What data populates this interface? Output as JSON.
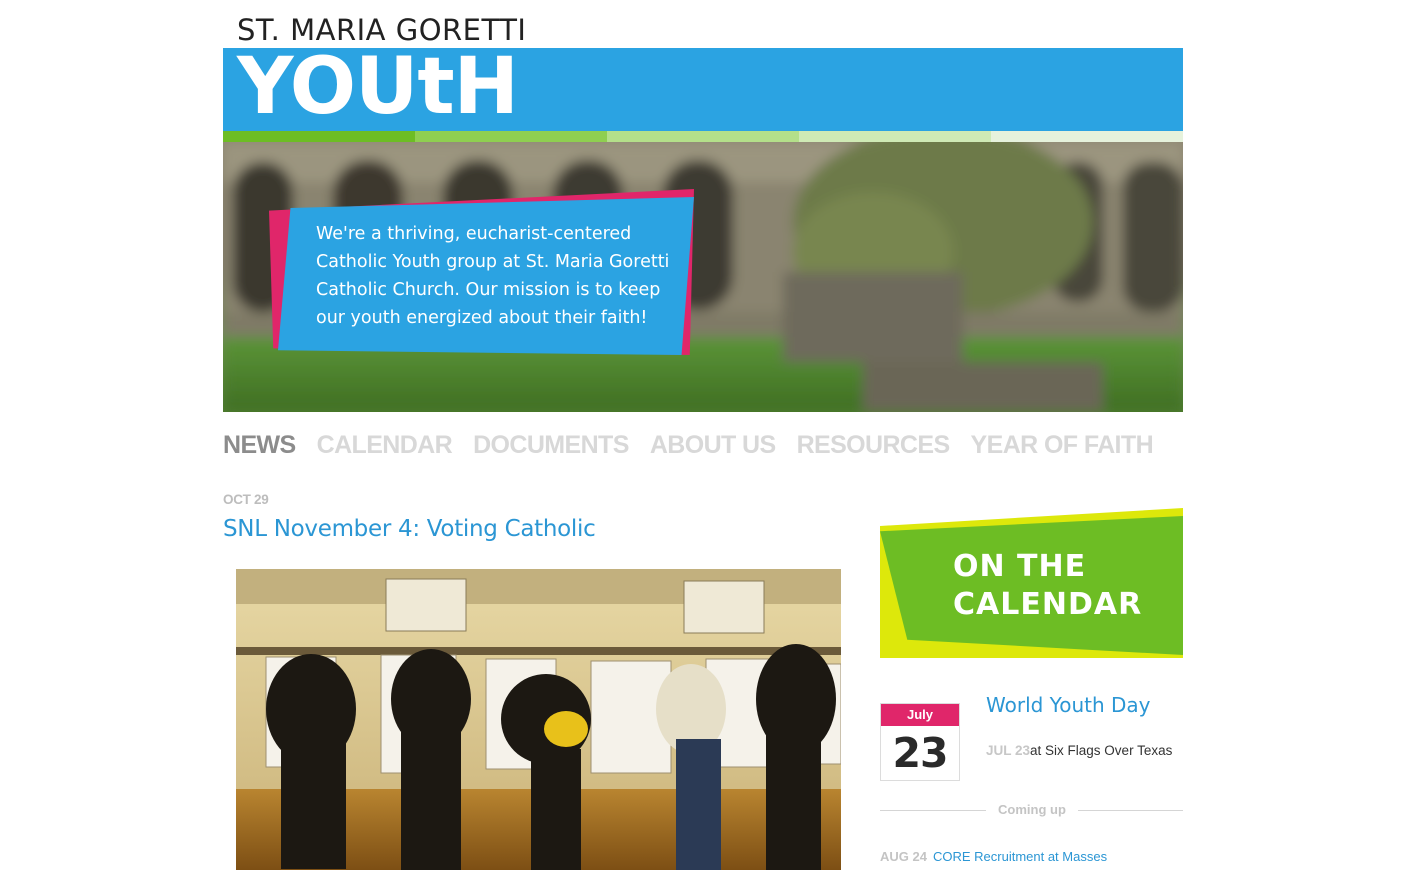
{
  "header": {
    "site_name": "ST. MARIA GORETTI",
    "wordmark": "YOUtH",
    "stripe_colors": [
      "#6dbd24",
      "#8fcf50",
      "#b4e08a",
      "#cfeab5",
      "#e6f2dc"
    ]
  },
  "hero": {
    "text": "We're a thriving, eucharist-centered Catholic Youth group at St. Maria Goretti Catholic Church. Our mission is to keep our youth energized about their faith!"
  },
  "nav": {
    "items": [
      {
        "label": "NEWS",
        "active": true
      },
      {
        "label": "CALENDAR",
        "active": false
      },
      {
        "label": "DOCUMENTS",
        "active": false
      },
      {
        "label": "ABOUT US",
        "active": false
      },
      {
        "label": "RESOURCES",
        "active": false
      },
      {
        "label": "YEAR OF FAITH",
        "active": false
      }
    ]
  },
  "post": {
    "date": "OCT 29",
    "title": "SNL November 4: Voting Catholic"
  },
  "sidebar": {
    "heading_line1": "ON THE",
    "heading_line2": "CALENDAR",
    "featured_event": {
      "month": "July",
      "day": "23",
      "title": "World Youth Day",
      "date": "JUL 23",
      "location": "at Six Flags Over Texas"
    },
    "coming_up_label": "Coming up",
    "upcoming": [
      {
        "date": "AUG 24",
        "title": "CORE Recruitment at Masses"
      }
    ]
  },
  "colors": {
    "brand_blue": "#2ba3e2",
    "accent_pink": "#e0266a",
    "accent_green": "#6dbd24",
    "accent_yellow": "#dde80b",
    "link_blue": "#2b96d4"
  }
}
